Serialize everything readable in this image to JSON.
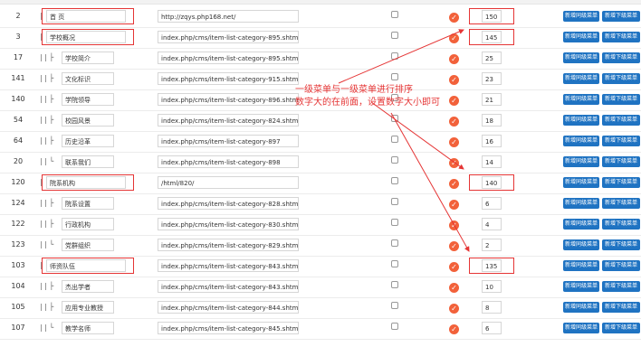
{
  "rows": [
    {
      "id": "2",
      "tree": "|  ├",
      "name": "首 页",
      "url": "http://zqys.php168.net/",
      "checked": false,
      "sort": "150",
      "indent": 1
    },
    {
      "id": "3",
      "tree": "|  ├",
      "name": "学校概况",
      "url": "index.php/cms/item-list-category-895.shtml",
      "checked": false,
      "sort": "145",
      "indent": 1
    },
    {
      "id": "17",
      "tree": "|  |  ├",
      "name": "学校简介",
      "url": "index.php/cms/item-list-category-895.shtml",
      "checked": false,
      "sort": "25",
      "indent": 2
    },
    {
      "id": "141",
      "tree": "|  |  ├",
      "name": "文化标识",
      "url": "index.php/cms/item-list-category-915.shtml",
      "checked": false,
      "sort": "23",
      "indent": 2
    },
    {
      "id": "140",
      "tree": "|  |  ├",
      "name": "学院领导",
      "url": "index.php/cms/item-list-category-896.shtml",
      "checked": false,
      "sort": "21",
      "indent": 2
    },
    {
      "id": "54",
      "tree": "|  |  ├",
      "name": "校园风景",
      "url": "index.php/cms/item-list-category-824.shtml",
      "checked": false,
      "sort": "18",
      "indent": 2
    },
    {
      "id": "64",
      "tree": "|  |  ├",
      "name": "历史沿革",
      "url": "index.php/cms/item-list-category-897",
      "checked": false,
      "sort": "16",
      "indent": 2
    },
    {
      "id": "20",
      "tree": "|  |  └",
      "name": "联系我们",
      "url": "index.php/cms/item-list-category-898",
      "checked": false,
      "sort": "14",
      "indent": 2
    },
    {
      "id": "120",
      "tree": "|  ├",
      "name": "院系机构",
      "url": "/html/820/",
      "checked": false,
      "sort": "140",
      "indent": 1
    },
    {
      "id": "124",
      "tree": "|  |  ├",
      "name": "院系设置",
      "url": "index.php/cms/item-list-category-828.shtml",
      "checked": false,
      "sort": "6",
      "indent": 2
    },
    {
      "id": "122",
      "tree": "|  |  ├",
      "name": "行政机构",
      "url": "index.php/cms/item-list-category-830.shtml",
      "checked": false,
      "sort": "4",
      "indent": 2
    },
    {
      "id": "123",
      "tree": "|  |  └",
      "name": "党群组织",
      "url": "index.php/cms/item-list-category-829.shtml",
      "checked": false,
      "sort": "2",
      "indent": 2
    },
    {
      "id": "103",
      "tree": "|  ├",
      "name": "师资队伍",
      "url": "index.php/cms/item-list-category-843.shtml",
      "checked": false,
      "sort": "135",
      "indent": 1
    },
    {
      "id": "104",
      "tree": "|  |  ├",
      "name": "杰出学者",
      "url": "index.php/cms/item-list-category-843.shtml",
      "checked": false,
      "sort": "10",
      "indent": 2
    },
    {
      "id": "105",
      "tree": "|  |  ├",
      "name": "应用专业教授",
      "url": "index.php/cms/item-list-category-844.shtml",
      "checked": false,
      "sort": "8",
      "indent": 2
    },
    {
      "id": "107",
      "tree": "|  |  └",
      "name": "教学名师",
      "url": "index.php/cms/item-list-category-845.shtml",
      "checked": false,
      "sort": "6",
      "indent": 2
    }
  ],
  "buttons": {
    "add_same": "新增同级菜单",
    "add_child": "新增下级菜单"
  },
  "annotation": {
    "line1": "一级菜单与一级菜单进行排序",
    "line2": "数字大的在前面，设置数字大小即可"
  },
  "icons": {
    "status": "check-circle-icon"
  },
  "colors": {
    "accent_button": "#1f73c2",
    "status_icon": "#f2613a",
    "annotation": "#e53535"
  }
}
